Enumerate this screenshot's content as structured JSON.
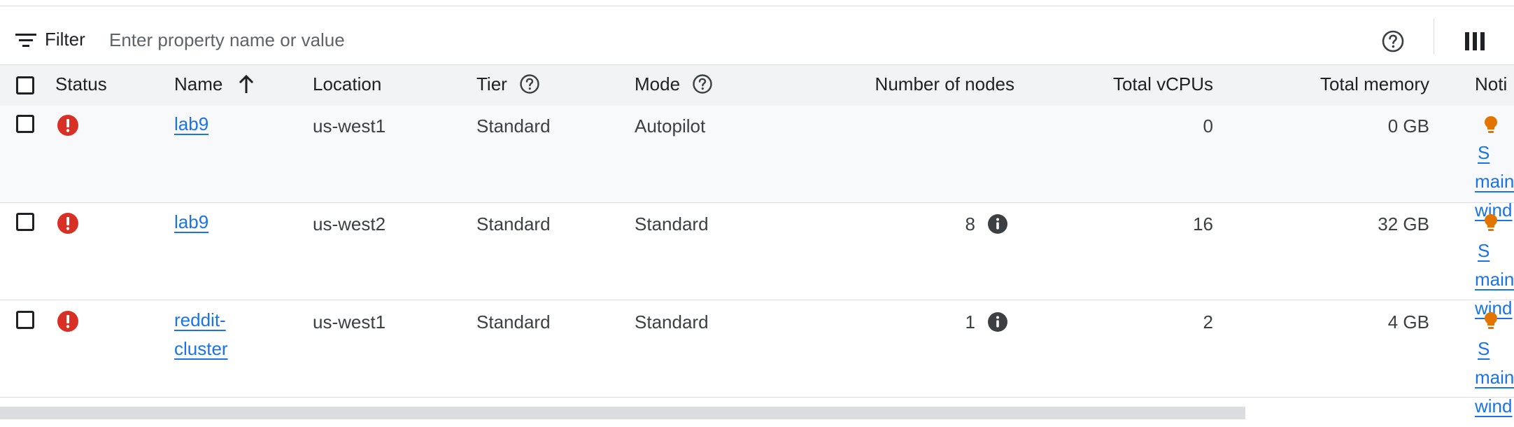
{
  "filter": {
    "label": "Filter",
    "placeholder": "Enter property name or value",
    "value": ""
  },
  "columns": {
    "status": "Status",
    "name": "Name",
    "location": "Location",
    "tier": "Tier",
    "mode": "Mode",
    "nodes": "Number of nodes",
    "vcpus": "Total vCPUs",
    "memory": "Total memory",
    "notifications": "Noti"
  },
  "rows": [
    {
      "name": "lab9",
      "location": "us-west1",
      "tier": "Standard",
      "mode": "Autopilot",
      "nodes": "",
      "vcpus": "0",
      "memory": "0 GB",
      "notification_lines": [
        "S",
        "main",
        "wind"
      ]
    },
    {
      "name": "lab9",
      "location": "us-west2",
      "tier": "Standard",
      "mode": "Standard",
      "nodes": "8",
      "vcpus": "16",
      "memory": "32 GB",
      "notification_lines": [
        "S",
        "main",
        "wind"
      ]
    },
    {
      "name": "reddit-cluster",
      "location": "us-west1",
      "tier": "Standard",
      "mode": "Standard",
      "nodes": "1",
      "vcpus": "2",
      "memory": "4 GB",
      "notification_lines": [
        "S",
        "main",
        "wind"
      ]
    }
  ],
  "colors": {
    "link": "#1a73e8",
    "error": "#d93025",
    "warning_bulb": "#e37400",
    "header_bg": "#f1f3f4"
  },
  "icons": {
    "filter": "filter-lines-icon",
    "help": "question-circle-icon",
    "columns": "column-display-icon",
    "sort": "arrow-up-icon",
    "status": "error-exclamation-icon",
    "nodes_info": "info-icon",
    "notification": "lightbulb-icon"
  }
}
